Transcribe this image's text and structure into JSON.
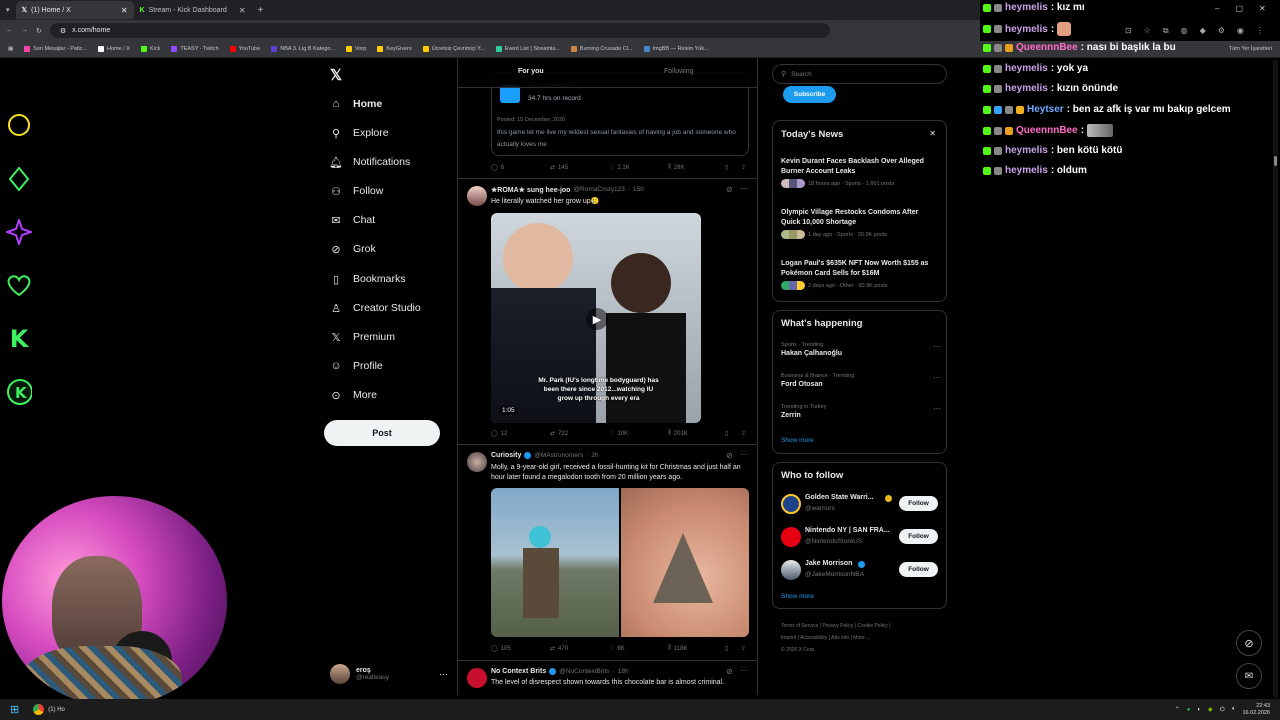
{
  "browser": {
    "tabs": [
      {
        "label": "(1) Home / X",
        "active": true,
        "color": "#000000"
      },
      {
        "label": "Stream - Kick Dashboard",
        "active": false,
        "color": "#53fc18"
      }
    ],
    "url": "x.com/home",
    "bookmarks": [
      "Son Mesajlar - Patic...",
      "Home / X",
      "Kick",
      "TEASY - Twitch",
      "YouTube",
      "NBA 3. Lig B Katego...",
      "Vorp",
      "KeyGivers",
      "Ücretsiz Çevrimiçi Y...",
      "Event List | Streamla...",
      "Burning Crusade Cl...",
      "ImgBB — Resim Yük..."
    ],
    "bookmarks_all": "Tüm Yer İşaretleri"
  },
  "x_nav": {
    "items": [
      {
        "label": "Home",
        "icon": "home-icon",
        "glyph": "⌂"
      },
      {
        "label": "Explore",
        "icon": "search-icon",
        "glyph": "⚲"
      },
      {
        "label": "Notifications",
        "icon": "bell-icon",
        "glyph": "🔔"
      },
      {
        "label": "Follow",
        "icon": "person-plus-icon",
        "glyph": "👤"
      },
      {
        "label": "Chat",
        "icon": "mail-icon",
        "glyph": "✉"
      },
      {
        "label": "Grok",
        "icon": "grok-icon",
        "glyph": "⊘"
      },
      {
        "label": "Bookmarks",
        "icon": "bookmark-icon",
        "glyph": "🔖"
      },
      {
        "label": "Creator Studio",
        "icon": "creator-icon",
        "glyph": "♙"
      },
      {
        "label": "Premium",
        "icon": "x-premium-icon",
        "glyph": "𝕏"
      },
      {
        "label": "Profile",
        "icon": "profile-icon",
        "glyph": "☺"
      },
      {
        "label": "More",
        "icon": "more-icon",
        "glyph": "⋯"
      }
    ],
    "post_label": "Post",
    "account": {
      "name": "eroş",
      "handle": "@realteasy"
    }
  },
  "feed": {
    "tabs": [
      "For you",
      "Following"
    ],
    "top_tweet": {
      "card_label": "Recommended",
      "card_stat": "34.7 hrs on record",
      "posted": "Posted: 15 December, 2020",
      "text": "this game let me live my wildest sexual fantasies of having a job and someone who actually loves me",
      "stats": [
        "6",
        "145",
        "2.1K",
        "28K"
      ]
    },
    "tweet1": {
      "name": "★ROMA★ sung hee-joo",
      "handle": "@RomaCristy123",
      "time": "15h",
      "text": "He literally watched her grow up🥲",
      "video_caption": "Mr. Park (IU's longtime bodyguard) has been there since 2012...watching IU grow up through every era",
      "duration": "1:05",
      "stats": [
        "12",
        "722",
        "10K",
        "201K"
      ]
    },
    "tweet2": {
      "name": "Curiosity",
      "handle": "@MAstronomers",
      "time": "2h",
      "text": "Molly, a 9-year-old girl, received a fossil-hunting kit for Christmas and just half an hour later found a megalodon tooth from 20 million years ago.",
      "stats": [
        "105",
        "470",
        "8K",
        "118K"
      ]
    },
    "tweet3": {
      "name": "No Context Brits",
      "handle": "@NoContextBrits",
      "time": "18h",
      "text": "The level of disrespect shown towards this chocolate bar is almost criminal."
    }
  },
  "right": {
    "search_placeholder": "Search",
    "subscribe_label": "Subscribe",
    "news_title": "Today's News",
    "news": [
      {
        "title": "Kevin Durant Faces Backlash Over Alleged Burner Account Leaks",
        "meta": "18 hours ago · Sports · 1,601 posts"
      },
      {
        "title": "Olympic Village Restocks Condoms After Quick 10,000 Shortage",
        "meta": "1 day ago · Sports · 20.9K posts"
      },
      {
        "title": "Logan Paul's $635K NFT Now Worth $155 as Pokémon Card Sells for $16M",
        "meta": "2 days ago · Other · 60.9K posts"
      }
    ],
    "happening_title": "What's happening",
    "trends": [
      {
        "context": "Sports · Trending",
        "name": "Hakan Çalhanoğlu"
      },
      {
        "context": "Business & finance · Trending",
        "name": "Ford Otosan"
      },
      {
        "context": "Trending in Turkey",
        "name": "Zerrin"
      }
    ],
    "show_more": "Show more",
    "wtf_title": "Who to follow",
    "who_to_follow": [
      {
        "name": "Golden State Warri...",
        "handle": "@warriors",
        "color": "#1d428a"
      },
      {
        "name": "Nintendo NY | SAN FRA...",
        "handle": "@NintendoStoreUS",
        "color": "#e60012"
      },
      {
        "name": "Jake Morrison",
        "handle": "@JakeMorrisonNBA",
        "color": "#c8d0d8"
      }
    ],
    "follow_label": "Follow",
    "footer_links": [
      "Terms of Service",
      "Privacy Policy",
      "Cookie Policy",
      "Imprint",
      "Accessibility",
      "Ads info",
      "More ..."
    ],
    "copyright": "© 2026 X Corp."
  },
  "chat": [
    {
      "user": "heymelis",
      "msg": ": kız mı",
      "color": "#c8a2e8"
    },
    {
      "user": "heymelis",
      "msg": ":",
      "color": "#c8a2e8"
    },
    {
      "user": "QueennnBee",
      "msg": ": nası bi başlık la bu",
      "color": "#ff6ec7"
    },
    {
      "user": "heymelis",
      "msg": ": yok ya",
      "color": "#c8a2e8"
    },
    {
      "user": "heymelis",
      "msg": ": kızın önünde",
      "color": "#c8a2e8"
    },
    {
      "user": "Heytser",
      "msg": ": ben az afk iş var mı bakıp gelcem",
      "color": "#6ea8ff"
    },
    {
      "user": "QueennnBee",
      "msg": ":",
      "color": "#ff6ec7"
    },
    {
      "user": "heymelis",
      "msg": ": ben kötü kötü",
      "color": "#c8a2e8"
    },
    {
      "user": "heymelis",
      "msg": ": oldum",
      "color": "#c8a2e8"
    }
  ],
  "taskbar": {
    "app_label": "(1) Ho",
    "time": "22:43",
    "date": "16.02.2026"
  }
}
